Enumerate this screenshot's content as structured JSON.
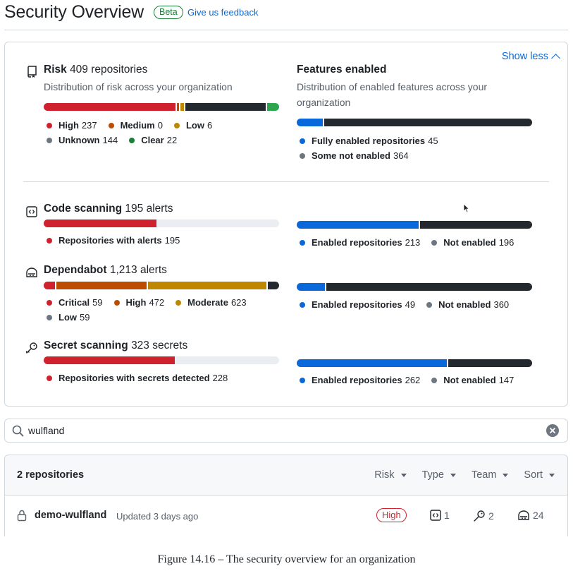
{
  "header": {
    "title": "Security Overview",
    "beta": "Beta",
    "feedback": "Give us feedback"
  },
  "panel": {
    "show_less": "Show less"
  },
  "risk": {
    "title": "Risk",
    "count": "409 repositories",
    "subtitle": "Distribution of risk across your organization",
    "segments": [
      {
        "label": "High",
        "value": 237,
        "color": "#cf222e"
      },
      {
        "label": "Medium",
        "value": 0,
        "color": "#bc4c00"
      },
      {
        "label": "Low",
        "value": 6,
        "color": "#bf8700"
      },
      {
        "label": "Unknown",
        "value": 144,
        "color": "#24292f"
      },
      {
        "label": "Clear",
        "value": 22,
        "color": "#2da44e"
      }
    ],
    "legend": {
      "high_label": "High",
      "high_value": "237",
      "medium_label": "Medium",
      "medium_value": "0",
      "low_label": "Low",
      "low_value": "6",
      "unknown_label": "Unknown",
      "unknown_value": "144",
      "clear_label": "Clear",
      "clear_value": "22"
    },
    "colors": {
      "high": "#cf222e",
      "medium": "#bc4c00",
      "low": "#bf8700",
      "unknown": "#6e7781",
      "clear": "#1a7f37"
    }
  },
  "features": {
    "title": "Features enabled",
    "subtitle": "Distribution of enabled features across your organization",
    "segments": [
      {
        "label": "Fully enabled repositories",
        "value": 45,
        "color": "#0969da"
      },
      {
        "label": "Some not enabled",
        "value": 364,
        "color": "#24292f"
      }
    ],
    "legend": {
      "fully_label": "Fully enabled repositories",
      "fully_value": "45",
      "some_label": "Some not enabled",
      "some_value": "364"
    }
  },
  "code_scanning": {
    "title": "Code scanning",
    "count": "195 alerts",
    "alert_bar": {
      "fraction": 0.48
    },
    "legend": {
      "alerts_label": "Repositories with alerts",
      "alerts_value": "195"
    },
    "enabled_segments": [
      {
        "label": "Enabled repositories",
        "value": 213,
        "color": "#0969da"
      },
      {
        "label": "Not enabled",
        "value": 196,
        "color": "#24292f"
      }
    ],
    "enabled_legend": {
      "enabled_label": "Enabled repositories",
      "enabled_value": "213",
      "not_label": "Not enabled",
      "not_value": "196"
    }
  },
  "dependabot": {
    "title": "Dependabot",
    "count": "1,213 alerts",
    "segments": [
      {
        "label": "Critical",
        "value": 59,
        "color": "#cf222e"
      },
      {
        "label": "High",
        "value": 472,
        "color": "#bc4c00"
      },
      {
        "label": "Moderate",
        "value": 623,
        "color": "#bf8700"
      },
      {
        "label": "Low",
        "value": 59,
        "color": "#24292f"
      }
    ],
    "legend": {
      "critical_label": "Critical",
      "critical_value": "59",
      "high_label": "High",
      "high_value": "472",
      "moderate_label": "Moderate",
      "moderate_value": "623",
      "low_label": "Low",
      "low_value": "59"
    },
    "enabled_segments": [
      {
        "label": "Enabled repositories",
        "value": 49,
        "color": "#0969da"
      },
      {
        "label": "Not enabled",
        "value": 360,
        "color": "#24292f"
      }
    ],
    "enabled_legend": {
      "enabled_label": "Enabled repositories",
      "enabled_value": "49",
      "not_label": "Not enabled",
      "not_value": "360"
    }
  },
  "secret_scanning": {
    "title": "Secret scanning",
    "count": "323 secrets",
    "alert_bar": {
      "fraction": 0.557
    },
    "legend": {
      "secrets_label": "Repositories with secrets detected",
      "secrets_value": "228"
    },
    "enabled_segments": [
      {
        "label": "Enabled repositories",
        "value": 262,
        "color": "#0969da"
      },
      {
        "label": "Not enabled",
        "value": 147,
        "color": "#24292f"
      }
    ],
    "enabled_legend": {
      "enabled_label": "Enabled repositories",
      "enabled_value": "262",
      "not_label": "Not enabled",
      "not_value": "147"
    }
  },
  "search": {
    "value": "wulfland"
  },
  "table": {
    "count": "2 repositories",
    "filters": [
      "Risk",
      "Type",
      "Team",
      "Sort"
    ],
    "rows": [
      {
        "name": "demo-wulfland",
        "updated": "Updated 3 days ago",
        "risk": "High",
        "code_alerts": "1",
        "secret_alerts": "2",
        "dependabot_alerts": "24"
      }
    ]
  },
  "caption": "Figure 14.16 – The security overview for an organization"
}
